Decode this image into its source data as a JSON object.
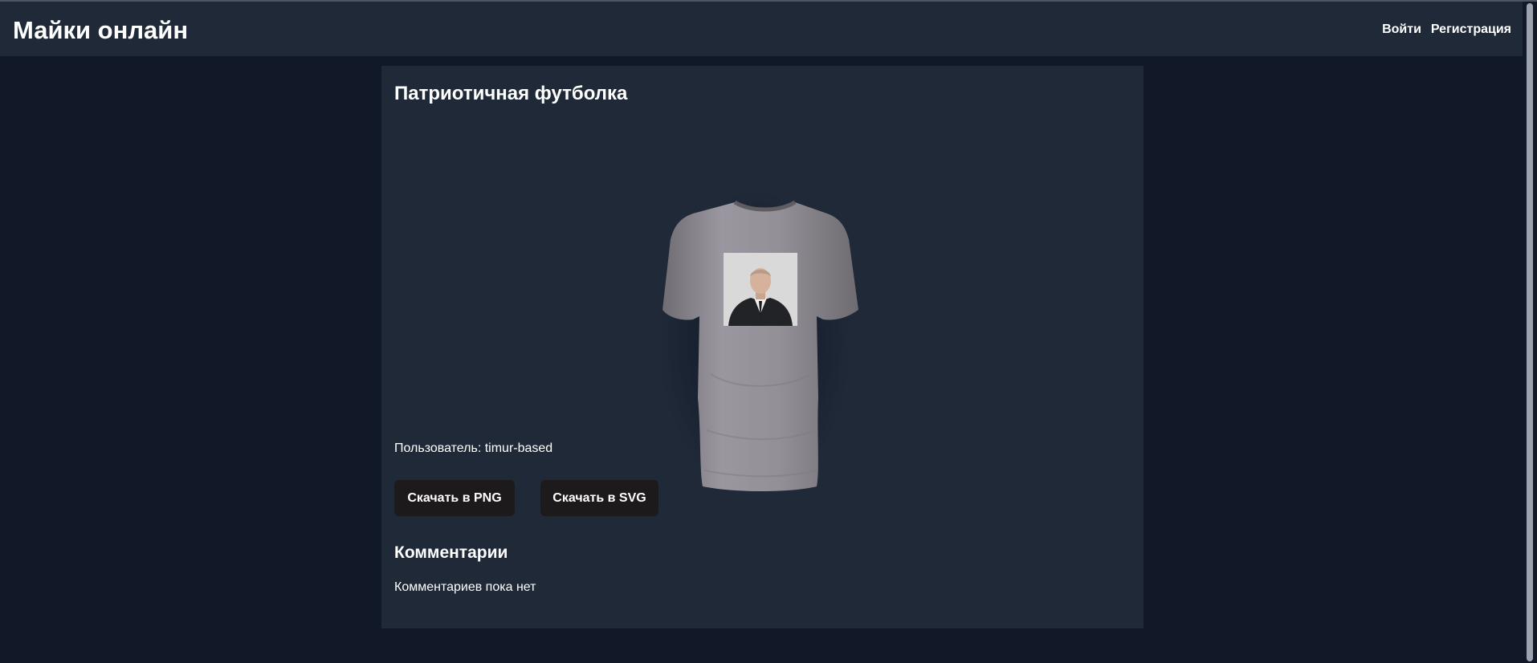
{
  "header": {
    "brand": "Майки онлайн",
    "login_label": "Войти",
    "register_label": "Регистрация"
  },
  "product": {
    "title": "Патриотичная футболка",
    "user_line": "Пользователь: timur-based",
    "download_png_label": "Скачать в PNG",
    "download_svg_label": "Скачать в SVG"
  },
  "comments": {
    "title": "Комментарии",
    "empty_text": "Комментариев пока нет"
  },
  "colors": {
    "page_background": "#111827",
    "panel_background": "#1f2937",
    "button_background": "#1c1a1a",
    "shirt_color": "#8f8c92"
  }
}
